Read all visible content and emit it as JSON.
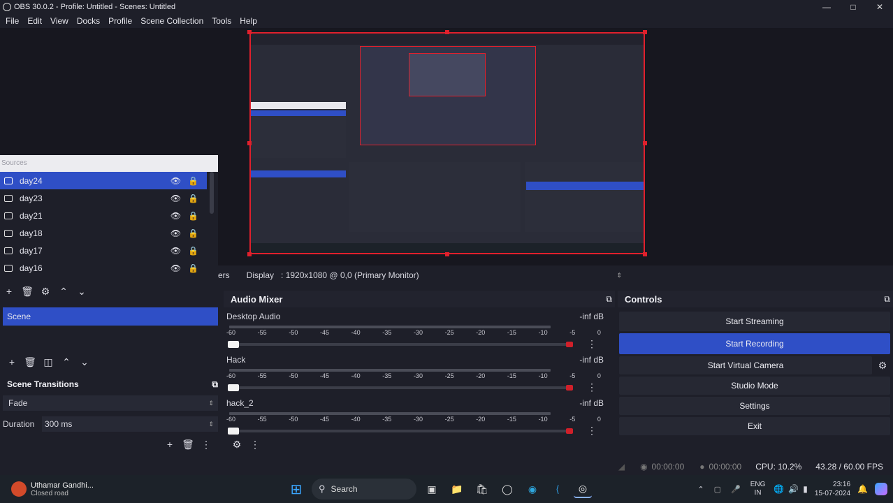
{
  "window": {
    "title": "OBS 30.0.2 - Profile: Untitled - Scenes: Untitled"
  },
  "menu": [
    "File",
    "Edit",
    "View",
    "Docks",
    "Profile",
    "Scene Collection",
    "Tools",
    "Help"
  ],
  "sources": {
    "header": "Sources",
    "items": [
      {
        "name": "day24",
        "selected": true
      },
      {
        "name": "day23"
      },
      {
        "name": "day21"
      },
      {
        "name": "day18"
      },
      {
        "name": "day17"
      },
      {
        "name": "day16"
      }
    ]
  },
  "scenes": {
    "items": [
      "Scene"
    ]
  },
  "source_bar": {
    "filters_fragment": "ers",
    "label": "Display",
    "value": ": 1920x1080 @ 0,0 (Primary Monitor)"
  },
  "transitions": {
    "title": "Scene Transitions",
    "type": "Fade",
    "duration_label": "Duration",
    "duration_value": "300 ms"
  },
  "audio_mixer": {
    "title": "Audio Mixer",
    "ticks": [
      "-60",
      "-55",
      "-50",
      "-45",
      "-40",
      "-35",
      "-30",
      "-25",
      "-20",
      "-15",
      "-10",
      "-5",
      "0"
    ],
    "channels": [
      {
        "name": "Desktop Audio",
        "level": "-inf dB"
      },
      {
        "name": "Hack",
        "level": "-inf dB"
      },
      {
        "name": "hack_2",
        "level": "-inf dB"
      }
    ]
  },
  "controls": {
    "title": "Controls",
    "buttons": [
      "Start Streaming",
      "Start Recording",
      "Start Virtual Camera",
      "Studio Mode",
      "Settings",
      "Exit"
    ]
  },
  "statusbar": {
    "live_time": "00:00:00",
    "rec_time": "00:00:00",
    "cpu": "CPU: 10.2%",
    "fps": "43.28 / 60.00 FPS"
  },
  "taskbar": {
    "user_name": "Uthamar Gandhi...",
    "user_status": "Closed road",
    "search": "Search",
    "lang": "ENG",
    "region": "IN",
    "time": "23:16",
    "date": "15-07-2024"
  },
  "colors": {
    "accent": "#2f4fc6",
    "selection_border": "#e0202c",
    "background": "#1e1f29"
  }
}
